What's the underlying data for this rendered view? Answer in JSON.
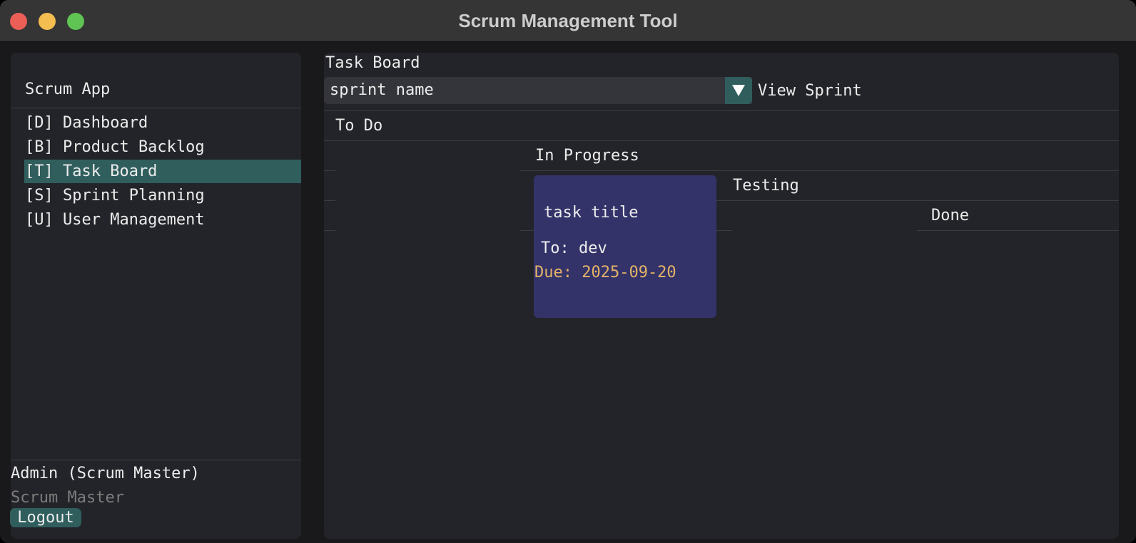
{
  "window": {
    "title": "Scrum Management Tool"
  },
  "sidebar": {
    "app_name": "Scrum App",
    "items": [
      {
        "label": "[D] Dashboard"
      },
      {
        "label": "[B] Product Backlog"
      },
      {
        "label": "[T] Task Board"
      },
      {
        "label": "[S] Sprint Planning"
      },
      {
        "label": "[U] User Management"
      }
    ],
    "active_item": "[T] Task Board",
    "user": {
      "name": "Admin (Scrum Master)",
      "role": "Scrum Master"
    },
    "logout_label": "Logout"
  },
  "main": {
    "title": "Task Board",
    "sprint_select": {
      "value": "sprint name"
    },
    "view_sprint_label": "View Sprint",
    "columns": [
      {
        "label": "To Do"
      },
      {
        "label": "In Progress"
      },
      {
        "label": "Testing"
      },
      {
        "label": "Done"
      }
    ],
    "task_card": {
      "title": "task title",
      "assignee": "To: dev",
      "due": "Due: 2025-09-20"
    }
  },
  "colors": {
    "accent": "#2f5e5d",
    "card": "#33336a",
    "due_text": "#e5b366"
  }
}
